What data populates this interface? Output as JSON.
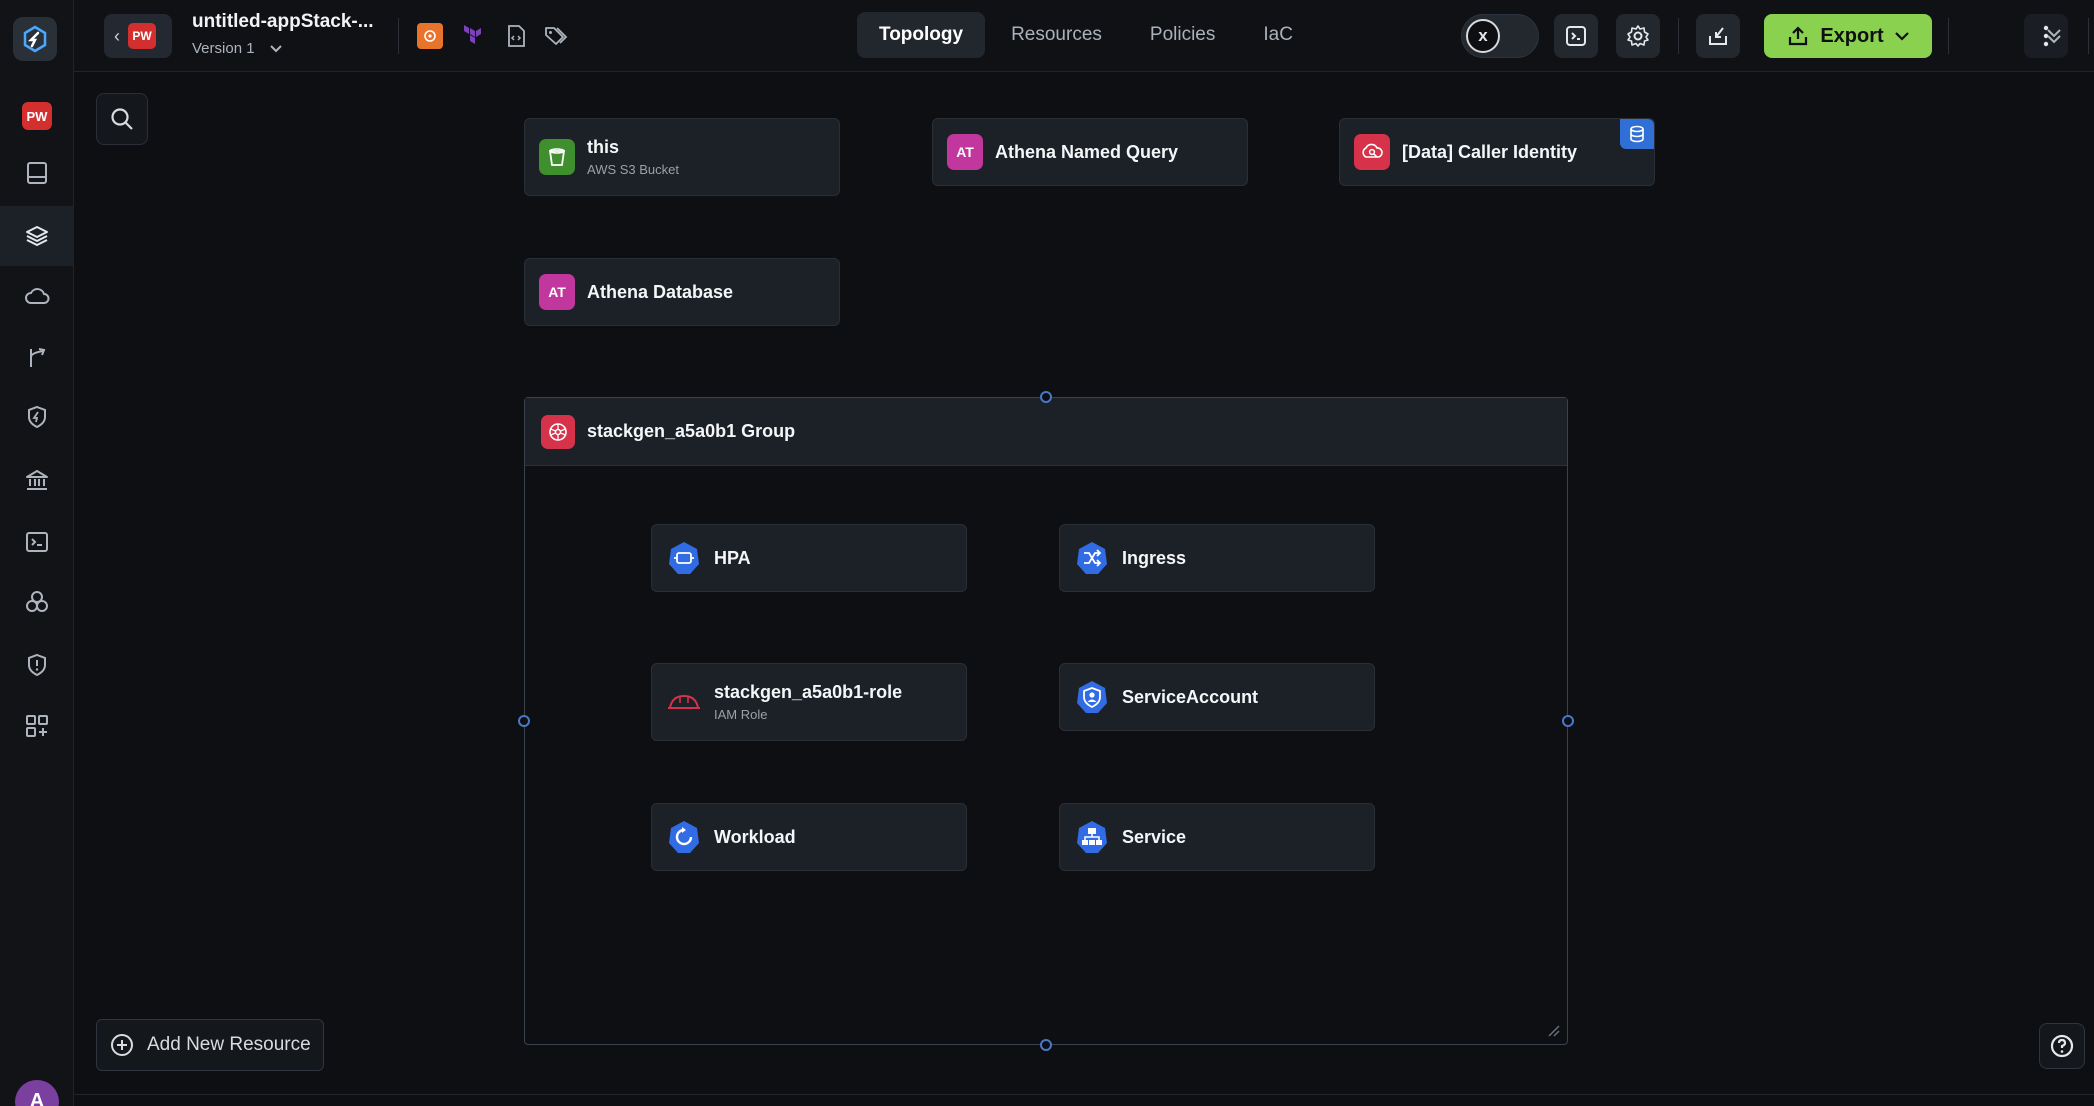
{
  "app": {
    "project_badge": "PW",
    "stack_title": "untitled-appStack-...",
    "version_label": "Version 1",
    "user_initial": "A"
  },
  "tabs": [
    {
      "label": "Topology",
      "active": true
    },
    {
      "label": "Resources",
      "active": false
    },
    {
      "label": "Policies",
      "active": false
    },
    {
      "label": "IaC",
      "active": false
    }
  ],
  "toolbar": {
    "export_label": "Export",
    "accent_color": "#8ad14f"
  },
  "canvas": {
    "nodes": [
      {
        "title": "this",
        "subtitle": "AWS S3 Bucket",
        "icon": "s3-bucket-icon",
        "color": "#3f8f2f"
      },
      {
        "title": "Athena Named Query",
        "icon_text": "AT",
        "color": "#c2379d"
      },
      {
        "title": "[Data] Caller Identity",
        "icon": "caller-identity-icon",
        "color": "#d6334a"
      },
      {
        "title": "Athena Database",
        "icon_text": "AT",
        "color": "#c2379d"
      }
    ],
    "group": {
      "title": "stackgen_a5a0b1 Group",
      "children": [
        {
          "title": "HPA",
          "icon": "hpa-icon"
        },
        {
          "title": "Ingress",
          "icon": "ingress-icon"
        },
        {
          "title": "stackgen_a5a0b1-role",
          "subtitle": "IAM Role",
          "icon": "iam-role-icon"
        },
        {
          "title": "ServiceAccount",
          "icon": "service-account-icon"
        },
        {
          "title": "Workload",
          "icon": "workload-icon"
        },
        {
          "title": "Service",
          "icon": "service-icon"
        }
      ]
    },
    "add_resource_label": "Add New Resource"
  }
}
